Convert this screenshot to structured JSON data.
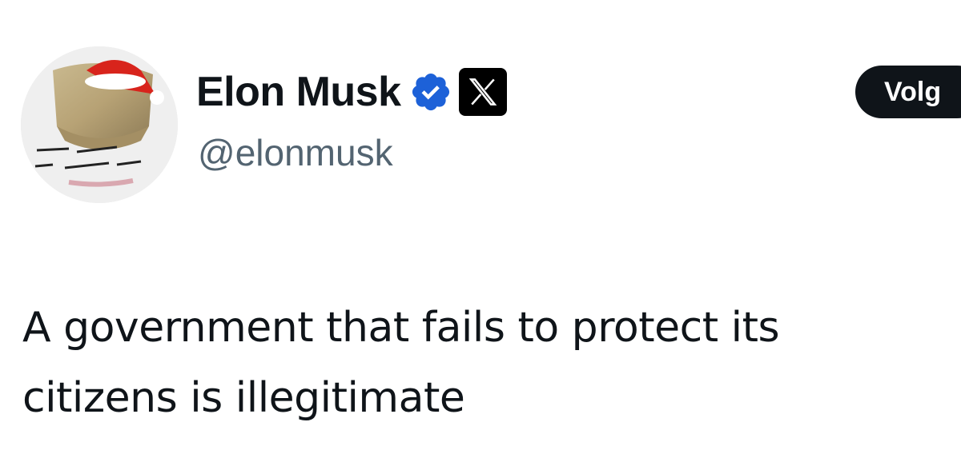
{
  "author": {
    "display_name": "Elon Musk",
    "handle": "@elonmusk",
    "verified_icon": "verified-badge-icon",
    "affiliate_badge_icon": "x-logo-icon",
    "avatar_icon": "avatar-image"
  },
  "follow_button": {
    "label": "Volg"
  },
  "tweet": {
    "line1": "A government that fails to protect its",
    "line2": "citizens is illegitimate"
  },
  "colors": {
    "text": "#0f1419",
    "secondary_text": "#536471",
    "verified_blue": "#1d9bf0",
    "button_bg": "#0f1419"
  }
}
